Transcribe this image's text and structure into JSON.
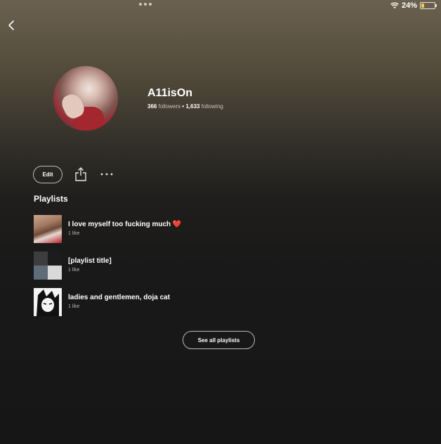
{
  "status_bar": {
    "battery_label": "24%",
    "battery_level": 0.24,
    "battery_color": "#f2c94c"
  },
  "navigation": {
    "back_icon": "chevron-left-icon"
  },
  "profile": {
    "username": "A11isOn",
    "followers_count": "366",
    "followers_label": "followers",
    "separator": "•",
    "following_count": "1,633",
    "following_label": "following"
  },
  "actions": {
    "edit_label": "Edit",
    "share_icon": "share-icon",
    "more_icon": "more-horizontal-icon"
  },
  "playlists": {
    "section_title": "Playlists",
    "items": [
      {
        "title": "I love myself too fucking much",
        "emoji": "❤️",
        "subtitle": "1 like"
      },
      {
        "title": "[playlist title]",
        "emoji": "",
        "subtitle": "1 like"
      },
      {
        "title": "ladies and gentlemen, doja cat",
        "emoji": "",
        "subtitle": "1 like"
      }
    ],
    "see_all_label": "See all playlists"
  }
}
